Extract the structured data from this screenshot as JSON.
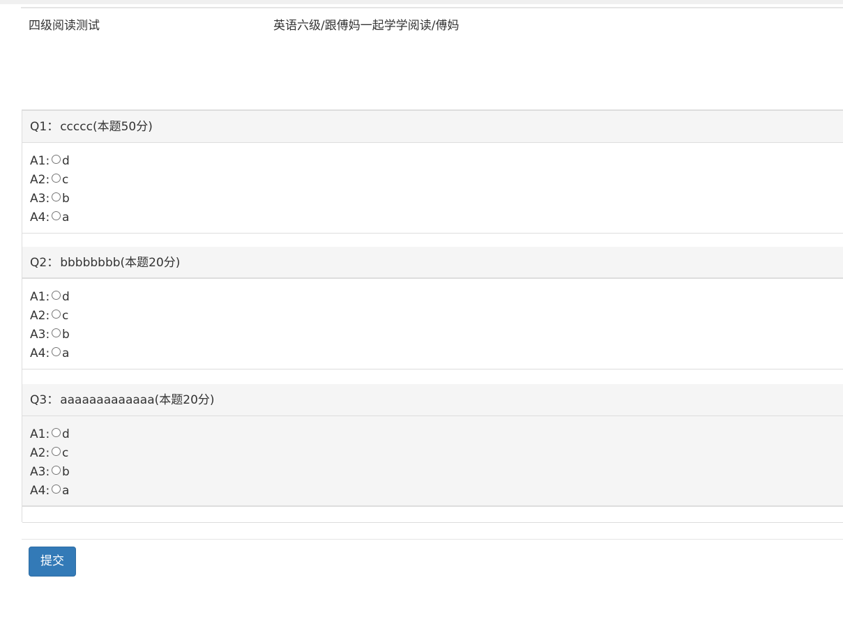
{
  "header": {
    "test_title": "四级阅读测试",
    "test_path": "英语六级/跟傅妈一起学学阅读/傅妈"
  },
  "questions": [
    {
      "label": "Q1",
      "sep": "：",
      "text": "ccccc",
      "score": "(本题50分)",
      "options": [
        {
          "num": "A1:",
          "text": "d"
        },
        {
          "num": "A2:",
          "text": "c"
        },
        {
          "num": "A3:",
          "text": "b"
        },
        {
          "num": "A4:",
          "text": "a"
        }
      ]
    },
    {
      "label": "Q2",
      "sep": "：",
      "text": "bbbbbbbb",
      "score": "(本题20分)",
      "options": [
        {
          "num": "A1:",
          "text": "d"
        },
        {
          "num": "A2:",
          "text": "c"
        },
        {
          "num": "A3:",
          "text": "b"
        },
        {
          "num": "A4:",
          "text": "a"
        }
      ]
    },
    {
      "label": "Q3",
      "sep": "：",
      "text": "aaaaaaaaaaaaa",
      "score": "(本题20分)",
      "options": [
        {
          "num": "A1:",
          "text": "d"
        },
        {
          "num": "A2:",
          "text": "c"
        },
        {
          "num": "A3:",
          "text": "b"
        },
        {
          "num": "A4:",
          "text": "a"
        }
      ]
    }
  ],
  "actions": {
    "submit_label": "提交"
  },
  "colors": {
    "primary": "#337ab7",
    "panel_heading": "#f5f5f5",
    "border": "#dddddd"
  }
}
